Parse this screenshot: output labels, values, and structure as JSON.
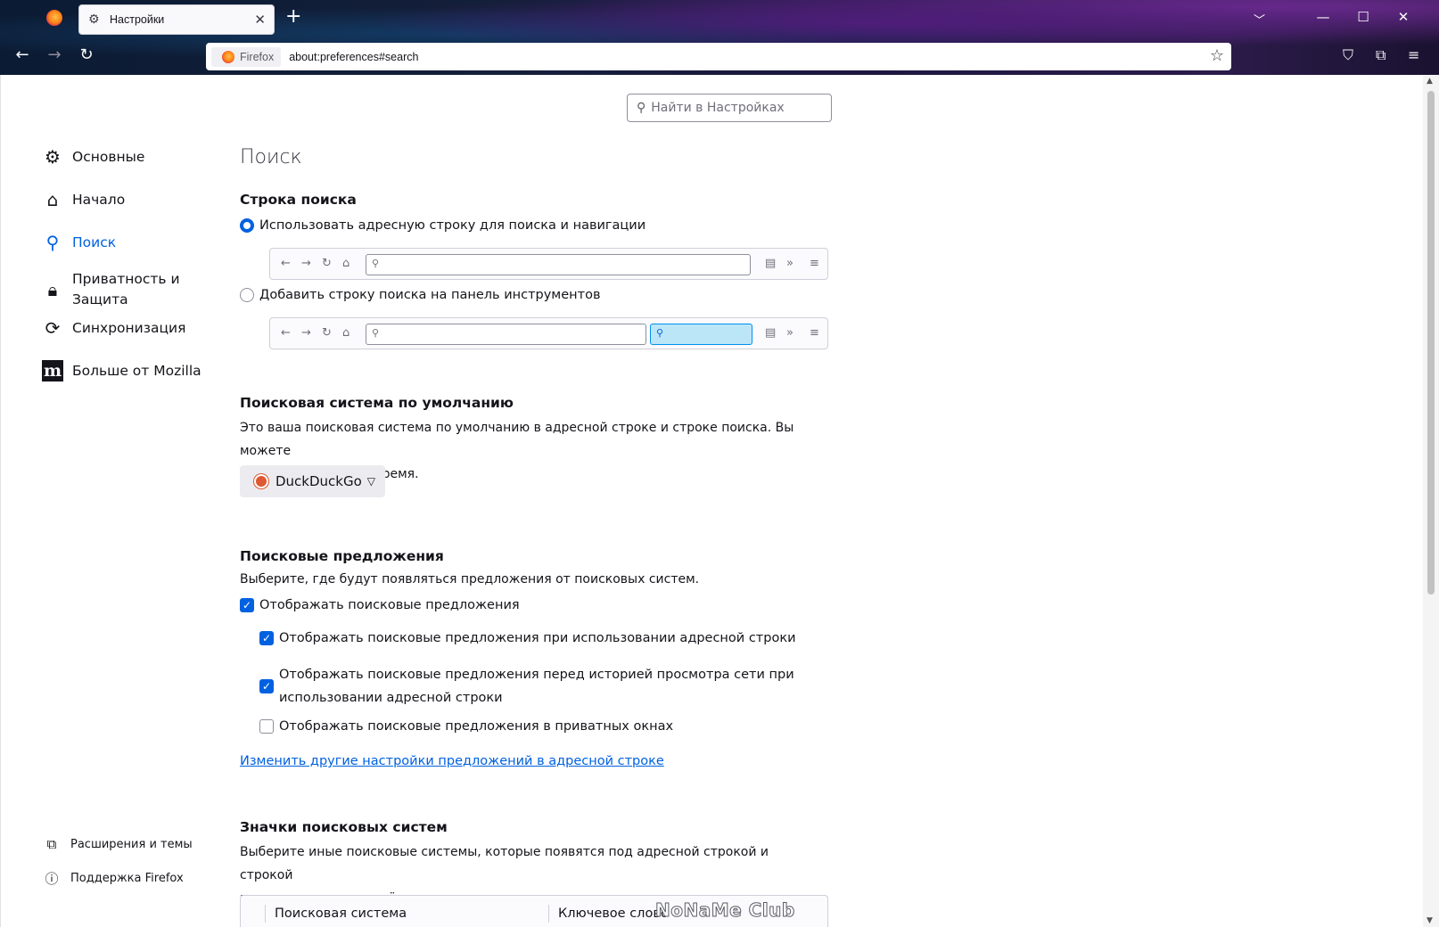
{
  "browser": {
    "tab_title": "Настройки",
    "identity_label": "Firefox",
    "url": "about:preferences#search"
  },
  "search_prefs": {
    "placeholder": "Найти в Настройках"
  },
  "sidebar": {
    "items": [
      {
        "label": "Основные",
        "icon": "gear-icon"
      },
      {
        "label": "Начало",
        "icon": "home-icon"
      },
      {
        "label": "Поиск",
        "icon": "search-icon",
        "active": true
      },
      {
        "label_line1": "Приватность и",
        "label_line2": "Защита",
        "icon": "lock-icon"
      },
      {
        "label": "Синхронизация",
        "icon": "sync-icon"
      },
      {
        "label": "Больше от Mozilla",
        "icon": "mozilla-icon",
        "glyph": "m"
      }
    ],
    "footer": [
      {
        "label": "Расширения и темы",
        "icon": "extensions-icon"
      },
      {
        "label": "Поддержка Firefox",
        "icon": "help-icon"
      }
    ]
  },
  "main": {
    "title": "Поиск",
    "search_bar": {
      "heading": "Строка поиска",
      "option_address": "Использовать адресную строку для поиска и навигации",
      "option_toolbar": "Добавить строку поиска на панель инструментов",
      "selected": "address"
    },
    "default_engine": {
      "heading": "Поисковая система по умолчанию",
      "desc_line1": "Это ваша поисковая система по умолчанию в адресной строке и строке поиска. Вы можете",
      "desc_line2": "сменить её в любое время.",
      "engine": "DuckDuckGo"
    },
    "suggestions": {
      "heading": "Поисковые предложения",
      "desc": "Выберите, где будут появляться предложения от поисковых систем.",
      "show": {
        "label": "Отображать поисковые предложения",
        "checked": true
      },
      "in_address": {
        "label": "Отображать поисковые предложения при использовании адресной строки",
        "checked": true
      },
      "before_history": {
        "label_line1": "Отображать поисковые предложения перед историей просмотра сети при",
        "label_line2": "использовании адресной строки",
        "checked": true
      },
      "in_private": {
        "label": "Отображать поисковые предложения в приватных окнах",
        "checked": false
      },
      "link": "Изменить другие настройки предложений в адресной строке"
    },
    "shortcuts": {
      "heading": "Значки поисковых систем",
      "desc_line1": "Выберите иные поисковые системы, которые появятся под адресной строкой и строкой",
      "desc_line2": "поиска, когда вы начнёте вводить ключевое слово.",
      "col_engine": "Поисковая система",
      "col_keyword": "Ключевое слово"
    }
  },
  "watermark": "NoNaMe Club",
  "colors": {
    "accent": "#0061e0",
    "text": "#15141a",
    "button_bg": "#ececf0"
  }
}
